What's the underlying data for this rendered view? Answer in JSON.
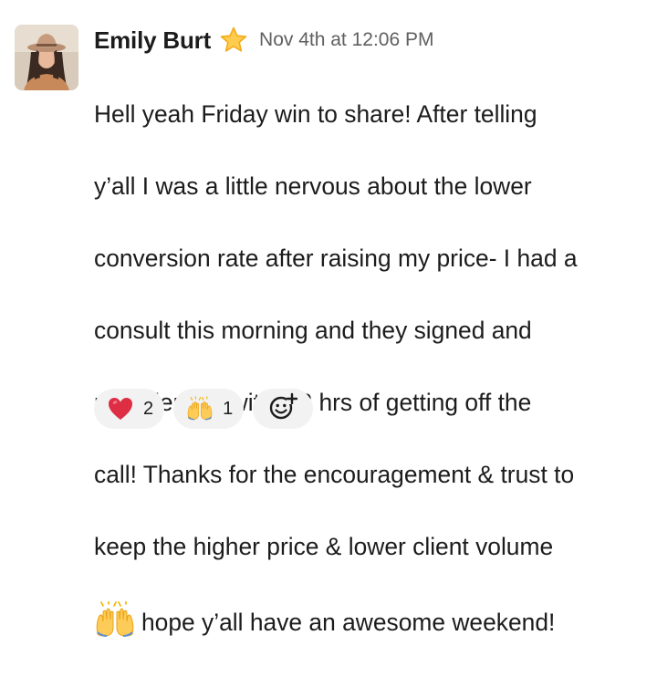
{
  "message": {
    "author": "Emily Burt",
    "status_emoji": "star-icon",
    "timestamp": "Nov 4th at 12:06 PM",
    "lines": [
      "Hell yeah Friday win to share! After telling",
      "y’all I was a little nervous about the lower",
      "conversion rate after raising my price- I had a",
      "consult this morning and they signed and",
      "paid deposit within 2 hrs of getting off the",
      "call! Thanks for the encouragement & trust to",
      "keep the higher price & lower client volume"
    ],
    "last_line_emoji": "raised-hands-icon",
    "last_line_text": "hope y’all have an awesome weekend!"
  },
  "reactions": [
    {
      "emoji": "red-heart-icon",
      "count": "2"
    },
    {
      "emoji": "raised-hands-icon",
      "count": "1"
    }
  ],
  "add_reaction": {
    "icon": "add-reaction-icon"
  },
  "colors": {
    "text": "#1d1c1d",
    "timestamp": "#616061",
    "reaction_bg": "#f2f2f2",
    "heart": "#dd2e44",
    "hands": "#fdcb58"
  }
}
